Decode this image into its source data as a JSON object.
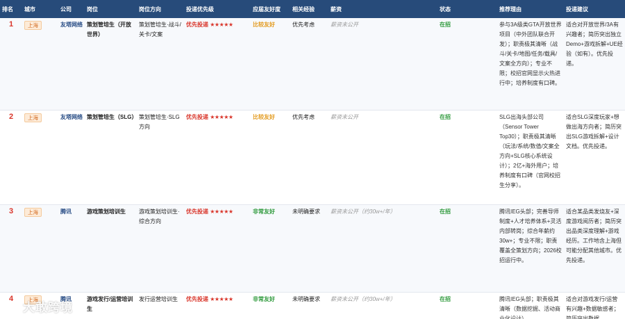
{
  "headers": [
    "排名",
    "城市",
    "公司",
    "岗位",
    "岗位方向",
    "投递优先级",
    "应届友好度",
    "相关经验",
    "薪资",
    "状态",
    "推荐理由",
    "投递建议"
  ],
  "rows": [
    {
      "rank": "1",
      "city": "上海",
      "company": "友塔网络",
      "position": "策划管培生（开放世界）",
      "direction": "策划管培生·战斗/关卡/文案",
      "priority_label": "优先投递",
      "stars": "★★★★★",
      "friendly": "比较友好",
      "friendly_level": "good",
      "experience": "优先考虑",
      "salary": "薪资未公开",
      "status": "在招",
      "reason": "参与3A级类GTA开放世界项目（中外团队联合开发）；职责极其清晰（战斗/关卡/地图/任务/载具/文案全方向）；专业不限；校招官网显示火热进行中；培养制度有口碑。",
      "advice": "适合对开放世界/3A有兴趣者；简历突出独立Demo+游戏拆解+UE经验（如有）。优先投递。"
    },
    {
      "rank": "2",
      "city": "上海",
      "company": "友塔网络",
      "position": "策划管培生（SLG）",
      "direction": "策划管培生·SLG方向",
      "priority_label": "优先投递",
      "stars": "★★★★★",
      "friendly": "比较友好",
      "friendly_level": "good",
      "experience": "优先考虑",
      "salary": "薪资未公开",
      "status": "在招",
      "reason": "SLG出海头部公司（Sensor Tower Top30）；职责极其清晰（玩法/系统/数值/文案全方向+SLG核心系统设计）；2亿+海外用户；培养制度有口碑（官网校招生分享）。",
      "advice": "适合SLG深度玩家+想做出海方向者；简历突出SLG游戏拆解+设计文档。优先投递。"
    },
    {
      "rank": "3",
      "city": "上海",
      "company": "腾讯",
      "position": "游戏策划培训生",
      "direction": "游戏策划培训生·综合方向",
      "priority_label": "优先投递",
      "stars": "★★★★★",
      "friendly": "非常友好",
      "friendly_level": "vgood",
      "experience": "未明确要求",
      "salary": "薪资未公开（约30w+/年）",
      "status": "在招",
      "reason": "腾讯IEG头部；完善导师制度+人才培养体系+灵活内部转岗；综合年薪约30w+；专业不限；职责覆盖全策划方向；2026校招运行中。",
      "advice": "适合某品类发烧友+深度游戏阅历者；简历突出品类深度理解+游戏经历。工作地含上海但可能分配其他城市。优先投递。"
    },
    {
      "rank": "4",
      "city": "上海",
      "company": "腾讯",
      "position": "游戏发行/运营培训生",
      "direction": "发行运营培训生",
      "priority_label": "优先投递",
      "stars": "★★★★★",
      "friendly": "非常友好",
      "friendly_level": "vgood",
      "experience": "未明确要求",
      "salary": "薪资未公开（约30w+/年）",
      "status": "在招",
      "reason": "腾讯IEG头部；职责极其清晰（数据挖掘、活动商业化设计）",
      "advice": "适合对游戏发行/运营有兴趣+数据敏感者；简历突出数据"
    }
  ],
  "watermark": "大敢跨境"
}
